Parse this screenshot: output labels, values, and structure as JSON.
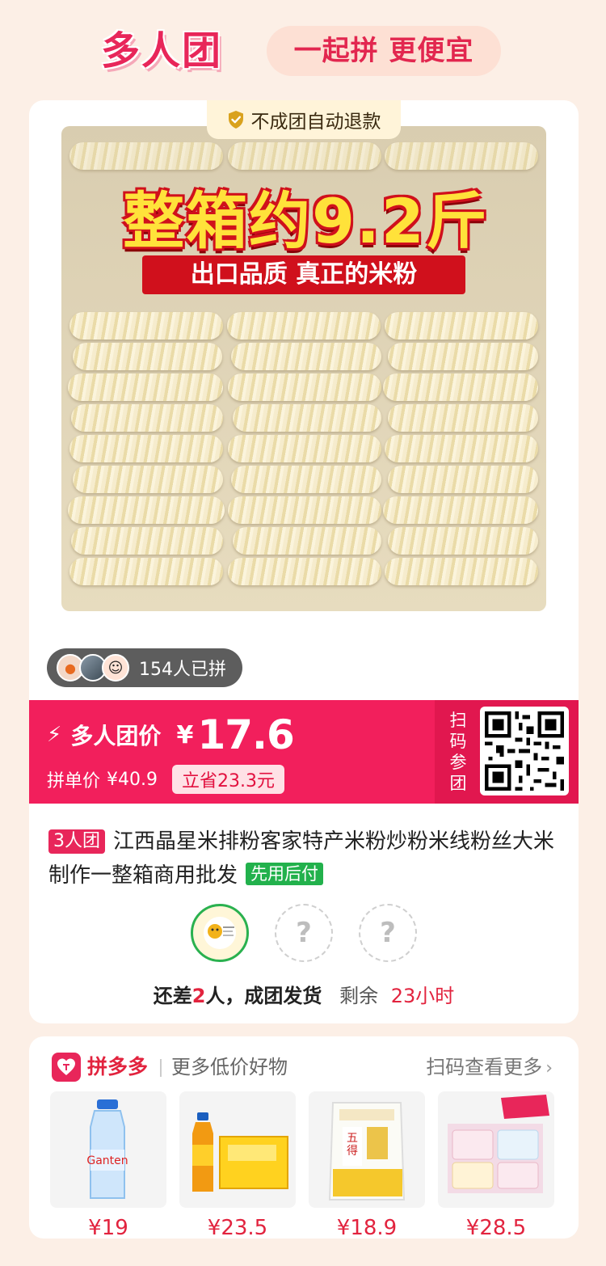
{
  "header": {
    "brand": "多人团",
    "slogan": "一起拼 更便宜"
  },
  "product": {
    "guarantee": "不成团自动退款",
    "promo_big": "整箱约9.2斤",
    "promo_small": "出口品质 真正的米粉",
    "joined_count_text": "154人已拼",
    "price_label": "多人团价",
    "currency": "¥",
    "price": "17.6",
    "single_price_label": "拼单价",
    "single_price": "¥40.9",
    "save_text": "立省23.3元",
    "qr_label": [
      "扫",
      "码",
      "参",
      "团"
    ],
    "team_badge": "3人团",
    "title": "江西晶星米排粉客家特产米粉炒粉米线粉丝大米制作一整箱商用批发",
    "pay_badge": "先用后付",
    "empty_slot_mark": "?",
    "status": {
      "prefix": "还差",
      "count": "2",
      "suffix": "人，成团发货",
      "remain_label": "剩余",
      "remain_time": "23小时"
    }
  },
  "more": {
    "brand": "拼多多",
    "label": "更多低价好物",
    "link": "扫码查看更多",
    "items": [
      {
        "price": "¥19",
        "icon": "water-bottle-icon"
      },
      {
        "price": "¥23.5",
        "icon": "tea-drink-icon"
      },
      {
        "price": "¥18.9",
        "icon": "rice-bag-icon"
      },
      {
        "price": "¥28.5",
        "icon": "tissue-pack-icon"
      }
    ]
  },
  "colors": {
    "brand_pink": "#e8265a",
    "price_bar": "#f21f5c",
    "green": "#22b14c",
    "background": "#fcefe6"
  }
}
